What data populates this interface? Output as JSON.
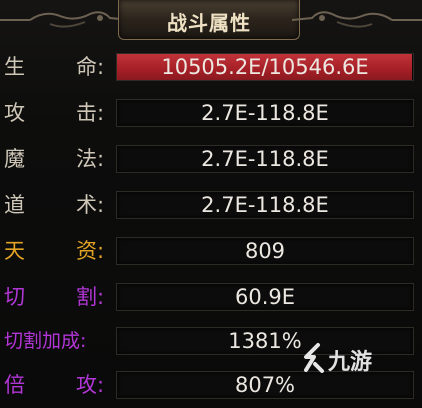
{
  "title": "战斗属性",
  "colors": {
    "label_default": "#cfc7b8",
    "label_gold": "#e3a425",
    "label_purple": "#b236d6",
    "hp_bar": "#b3242b",
    "value_text": "#ece8e1"
  },
  "stats": [
    {
      "label_a": "生",
      "label_b": "命:",
      "value": "10505.2E/10546.6E",
      "hp_fill": 0.996
    },
    {
      "label_a": "攻",
      "label_b": "击:",
      "value": "2.7E-118.8E"
    },
    {
      "label_a": "魔",
      "label_b": "法:",
      "value": "2.7E-118.8E"
    },
    {
      "label_a": "道",
      "label_b": "术:",
      "value": "2.7E-118.8E"
    },
    {
      "label_a": "天",
      "label_b": "资:",
      "value": "809"
    },
    {
      "label_a": "切",
      "label_b": "割:",
      "value": "60.9E"
    },
    {
      "label_full": "切割加成:",
      "value": "1381%"
    },
    {
      "label_a": "倍",
      "label_b": "攻:",
      "value": "807%"
    }
  ],
  "watermark": {
    "text": "九游",
    "icon": "jiuyou-logo-icon"
  }
}
